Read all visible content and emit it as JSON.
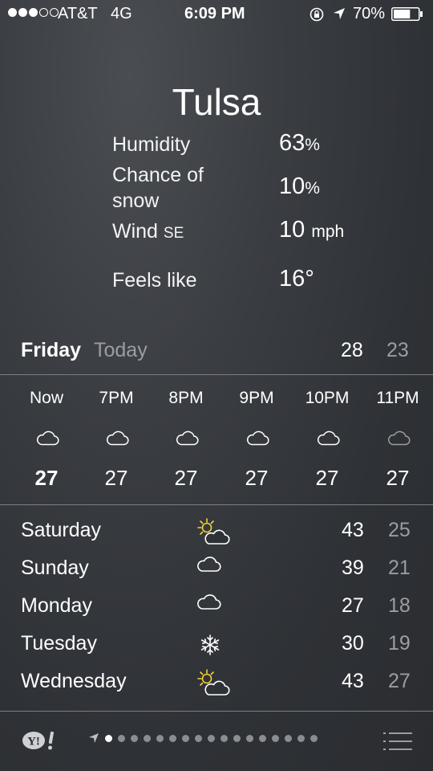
{
  "status_bar": {
    "signal_dots": [
      true,
      true,
      true,
      false,
      false
    ],
    "carrier": "AT&T",
    "network": "4G",
    "time": "6:09 PM",
    "icons": [
      "rotation-lock-icon",
      "location-arrow-icon"
    ],
    "battery_percent": "70%",
    "battery_level": 0.7
  },
  "current": {
    "city": "Tulsa",
    "humidity_label": "Humidity",
    "humidity_value": "63",
    "humidity_unit": "%",
    "snow_label_line1": "Chance of",
    "snow_label_line2": "snow",
    "snow_value": "10",
    "snow_unit": "%",
    "wind_label": "Wind",
    "wind_dir": "SE",
    "wind_value": "10",
    "wind_unit": "mph",
    "feels_label": "Feels like",
    "feels_value": "16°"
  },
  "today": {
    "day": "Friday",
    "label": "Today",
    "high": "28",
    "low": "23"
  },
  "hourly": [
    {
      "time": "Now",
      "temp": "27",
      "icon": "cloud-icon",
      "current": true
    },
    {
      "time": "7PM",
      "temp": "27",
      "icon": "cloud-icon"
    },
    {
      "time": "8PM",
      "temp": "27",
      "icon": "cloud-icon"
    },
    {
      "time": "9PM",
      "temp": "27",
      "icon": "cloud-icon"
    },
    {
      "time": "10PM",
      "temp": "27",
      "icon": "cloud-icon"
    },
    {
      "time": "11PM",
      "temp": "27",
      "icon": "cloud-icon"
    }
  ],
  "daily": [
    {
      "day": "Saturday",
      "icon": "partly-sunny-icon",
      "high": "43",
      "low": "25"
    },
    {
      "day": "Sunday",
      "icon": "cloud-icon",
      "high": "39",
      "low": "21"
    },
    {
      "day": "Monday",
      "icon": "cloud-icon",
      "high": "27",
      "low": "18"
    },
    {
      "day": "Tuesday",
      "icon": "snowflake-icon",
      "high": "30",
      "low": "19"
    },
    {
      "day": "Wednesday",
      "icon": "partly-sunny-icon",
      "high": "43",
      "low": "27"
    }
  ],
  "bottom_bar": {
    "logo": "Y!",
    "page_count": 17,
    "active_page": 0,
    "icons": [
      "location-arrow-icon",
      "list-icon"
    ]
  },
  "colors": {
    "background": "#2e3135",
    "muted_text": "#9a9da2",
    "sun_yellow": "#f4d23c",
    "divider": "#7b7e82"
  }
}
